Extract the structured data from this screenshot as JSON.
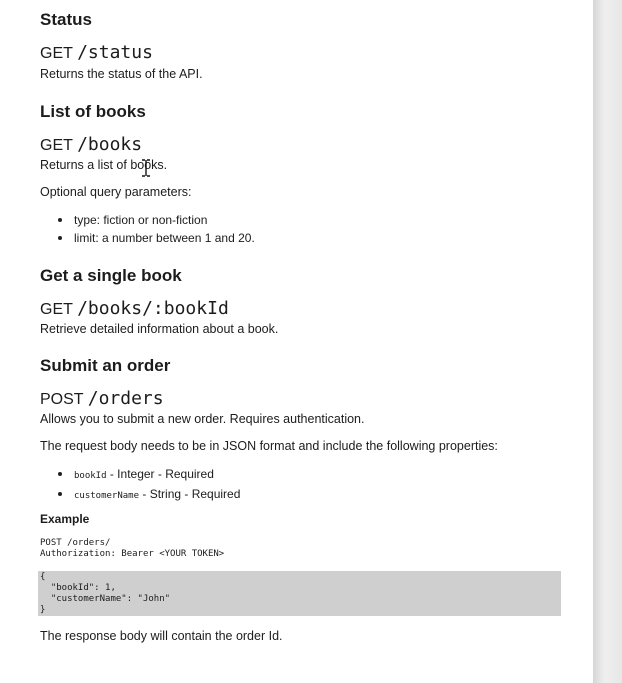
{
  "sections": [
    {
      "heading": "Status",
      "method": "GET",
      "path": "/status",
      "description": "Returns the status of the API."
    },
    {
      "heading": "List of books",
      "method": "GET",
      "path": "/books",
      "description": "Returns a list of books.",
      "params_intro": "Optional query parameters:",
      "params": [
        "type: fiction or non-fiction",
        "limit: a number between 1 and 20."
      ]
    },
    {
      "heading": "Get a single book",
      "method": "GET",
      "path": "/books/:bookId",
      "description": "Retrieve detailed information about a book."
    },
    {
      "heading": "Submit an order",
      "method": "POST",
      "path": "/orders",
      "description": "Allows you to submit a new order. Requires authentication.",
      "body_intro": "The request body needs to be in JSON format and include the following properties:",
      "properties": [
        {
          "name": "bookId",
          "text": " - Integer - Required"
        },
        {
          "name": "customerName",
          "text": " - String - Required"
        }
      ],
      "example_heading": "Example",
      "example_request": "POST /orders/\nAuthorization: Bearer <YOUR TOKEN>",
      "example_body": "{\n  \"bookId\": 1,\n  \"customerName\": \"John\"\n}",
      "response_note": "The response body will contain the order Id."
    }
  ]
}
